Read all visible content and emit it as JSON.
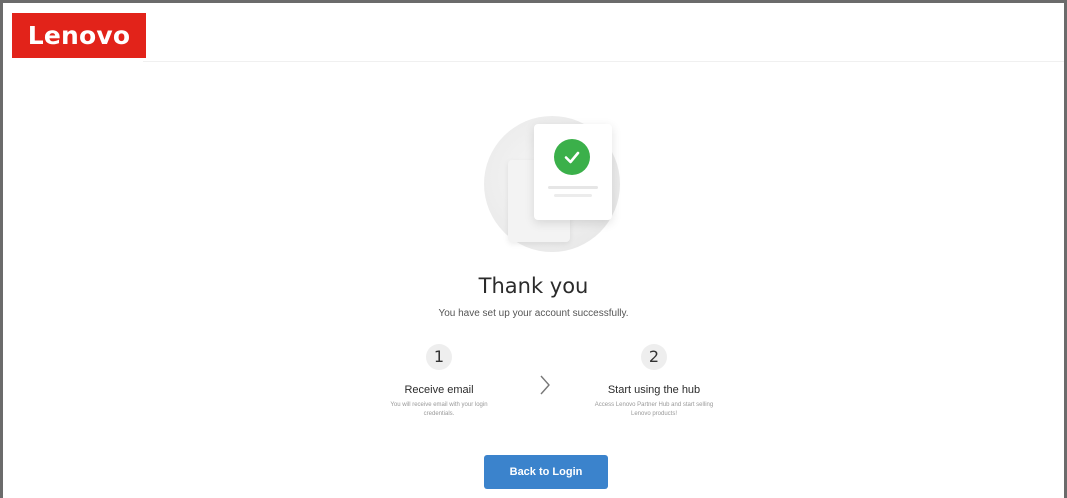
{
  "header": {
    "logo_text": "Lenovo",
    "logo_color": "#e2231a"
  },
  "illustration": {
    "icon": "checkmark-circle-icon",
    "accent_color": "#3bb04a"
  },
  "main": {
    "title": "Thank you",
    "subtitle": "You have set up your account successfully.",
    "steps": [
      {
        "number": "1",
        "label": "Receive email",
        "description": "You will receive email with your login credentials."
      },
      {
        "number": "2",
        "label": "Start using the hub",
        "description": "Access Lenovo Partner Hub and start selling Lenovo products!"
      }
    ],
    "separator_icon": "chevron-right-icon",
    "button_label": "Back to Login",
    "button_color": "#3b83cc"
  }
}
